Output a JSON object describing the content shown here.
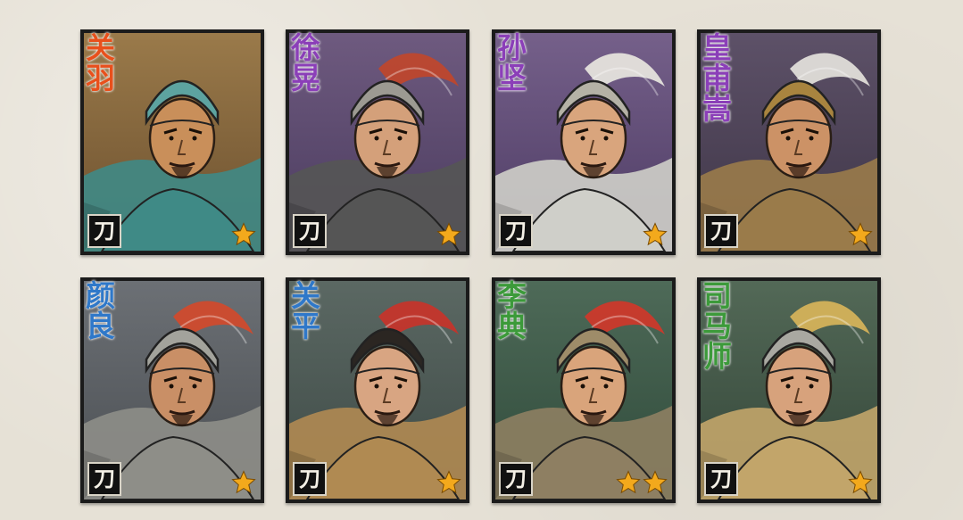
{
  "colors": {
    "orange_name": "#e8501c",
    "purple_name": "#8b3fb8",
    "blue_name": "#2f78c9",
    "green_name": "#3c9a3a",
    "star_fill": "#f3a91c"
  },
  "generals": [
    {
      "name": "关羽",
      "name_color": "#e8501c",
      "bg": "#6b4f2e",
      "bg2": "#9a7a4a",
      "skin": "#c98f5a",
      "armor": "#3f8a86",
      "helmet": "#5da3a0",
      "type_label": "刀",
      "stars": 1,
      "plume": "none"
    },
    {
      "name": "徐晃",
      "name_color": "#8b3fb8",
      "bg": "#4a3b5e",
      "bg2": "#6e5a7f",
      "skin": "#d4a07a",
      "armor": "#555",
      "helmet": "#9c9a92",
      "type_label": "刀",
      "stars": 1,
      "plume": "#c0462b"
    },
    {
      "name": "孙坚",
      "name_color": "#8b3fb8",
      "bg": "#4d3b63",
      "bg2": "#75608a",
      "skin": "#d9a57d",
      "armor": "#cfcfc9",
      "helmet": "#b5b2a6",
      "type_label": "刀",
      "stars": 1,
      "plume": "#e8e6df"
    },
    {
      "name": "皇甫嵩",
      "name_color": "#8b3fb8",
      "bg": "#3e3546",
      "bg2": "#5d5168",
      "skin": "#cc9266",
      "armor": "#9a7b4a",
      "helmet": "#a8843f",
      "type_label": "刀",
      "stars": 1,
      "plume": "#e4e2dc"
    },
    {
      "name": "颜良",
      "name_color": "#2f78c9",
      "bg": "#4a4e52",
      "bg2": "#6c7075",
      "skin": "#c98f66",
      "armor": "#8e8e88",
      "helmet": "#a3a39c",
      "type_label": "刀",
      "stars": 1,
      "plume": "#d24a2b"
    },
    {
      "name": "关平",
      "name_color": "#2f78c9",
      "bg": "#3e4a46",
      "bg2": "#5b6863",
      "skin": "#d8a582",
      "armor": "#b08a52",
      "helmet": "#2b2622",
      "type_label": "刀",
      "stars": 1,
      "plume": "#c8332a"
    },
    {
      "name": "李典",
      "name_color": "#3c9a3a",
      "bg": "#2f4a3a",
      "bg2": "#4e6a58",
      "skin": "#d9a47b",
      "armor": "#8e7f62",
      "helmet": "#9e8c69",
      "type_label": "刀",
      "stars": 2,
      "plume": "#d0372a"
    },
    {
      "name": "司马师",
      "name_color": "#3c9a3a",
      "bg": "#334538",
      "bg2": "#536957",
      "skin": "#d7a27c",
      "armor": "#c2a56a",
      "helmet": "#a9a8a1",
      "type_label": "刀",
      "stars": 1,
      "plume": "#d8b45a"
    }
  ]
}
